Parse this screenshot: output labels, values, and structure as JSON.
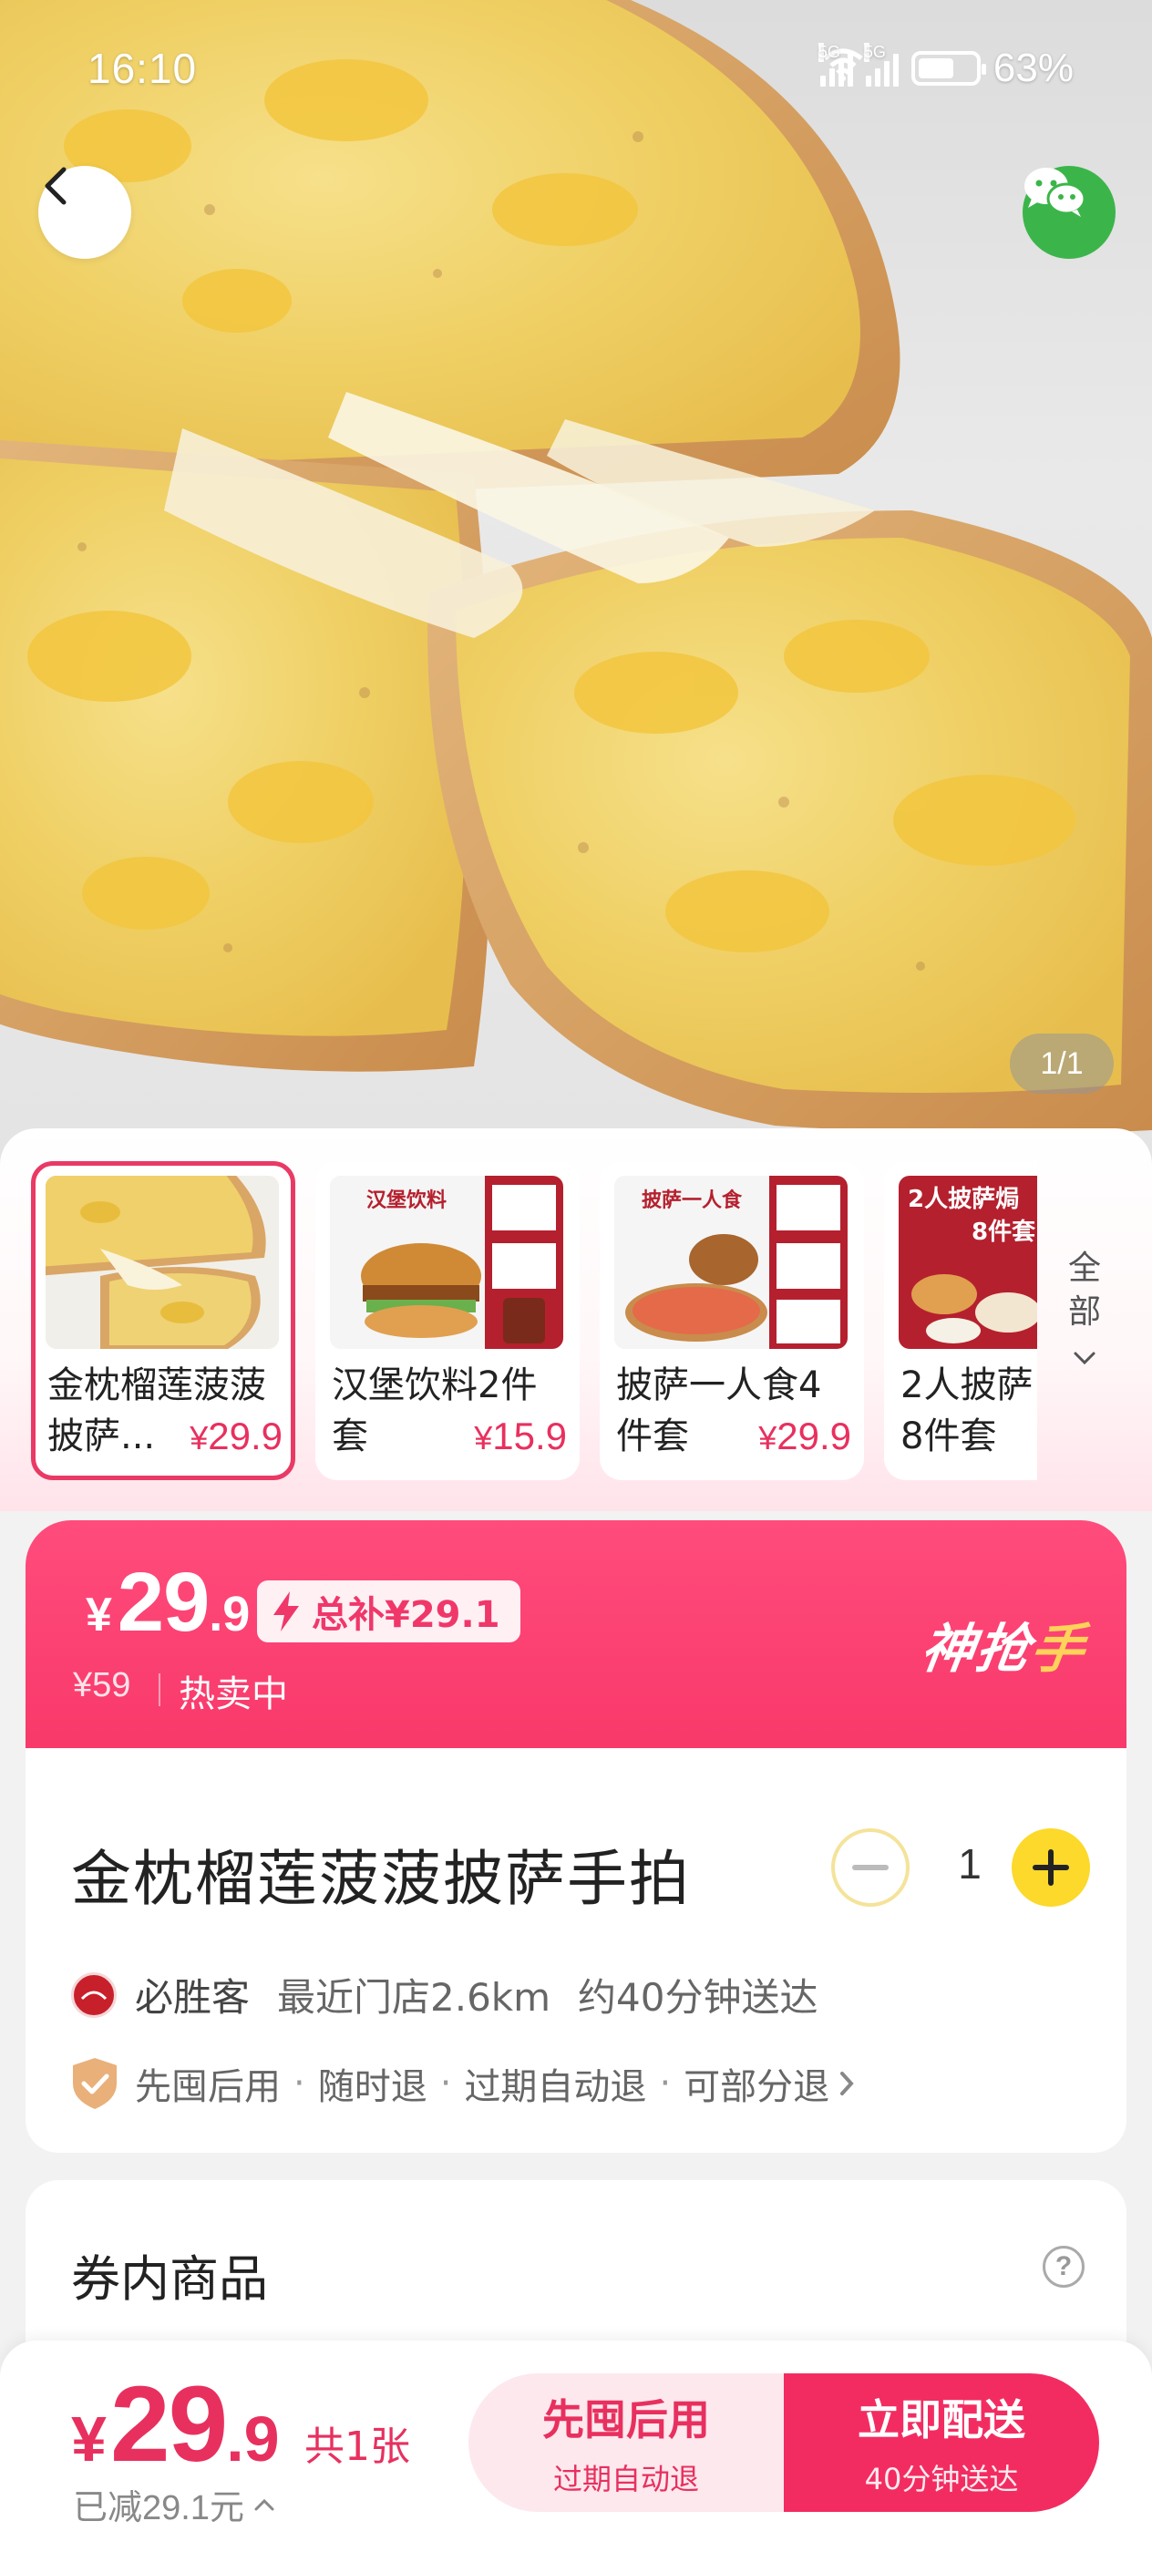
{
  "status_bar": {
    "time": "16:10",
    "signal1_label": "5G",
    "signal2_label": "5G",
    "battery_percent": "63%",
    "battery_level": 0.63
  },
  "hero": {
    "page_indicator": "1/1"
  },
  "variants": {
    "items": [
      {
        "name": "金枕榴莲菠菠披萨...",
        "price": "29.9",
        "currency": "¥",
        "selected": true
      },
      {
        "name": "汉堡饮料2件套",
        "price": "15.9",
        "currency": "¥",
        "selected": false
      },
      {
        "name": "披萨一人食4件套",
        "price": "29.9",
        "currency": "¥",
        "selected": false
      },
      {
        "name": "2人披萨8件套",
        "price": "",
        "currency": "",
        "selected": false
      }
    ],
    "thumb_texts": {
      "item2_badge": "汉堡饮料",
      "item3_badge": "披萨一人食",
      "item4_badge": "2人披萨焗",
      "item4_count": "8件套"
    },
    "all_label_line1": "全",
    "all_label_line2": "部"
  },
  "price_banner": {
    "currency": "¥",
    "price_int": "29",
    "price_dec": ".9",
    "subsidy": "总补¥29.1",
    "original_price": "¥59",
    "status": "热卖中",
    "brand_part1": "神抢",
    "brand_part2": "手"
  },
  "product": {
    "title": "金枕榴莲菠菠披萨手拍",
    "quantity": "1",
    "store_name": "必胜客",
    "store_distance": "最近门店2.6km",
    "delivery_time": "约40分钟送达",
    "guarantees": [
      "先囤后用",
      "随时退",
      "过期自动退",
      "可部分退"
    ]
  },
  "goods_section": {
    "title": "券内商品",
    "help_symbol": "?"
  },
  "bottom_bar": {
    "currency": "¥",
    "price_int": "29",
    "price_dec": ".9",
    "count": "共1张",
    "saved": "已减29.1元",
    "btn_later_label": "先囤后用",
    "btn_later_sub": "过期自动退",
    "btn_now_label": "立即配送",
    "btn_now_sub": "40分钟送达"
  },
  "colors": {
    "accent": "#f22c61",
    "accent_light": "#fde8ee",
    "plus_button": "#fcd92a",
    "wechat": "#3bb54a"
  },
  "icons": [
    "back-arrow-icon",
    "wechat-icon",
    "wifi-icon",
    "signal-icon",
    "battery-icon",
    "minus-icon",
    "plus-icon",
    "shield-check-icon",
    "chevron-right-icon",
    "chevron-down-icon",
    "chevron-up-icon",
    "help-icon",
    "bolt-icon"
  ]
}
